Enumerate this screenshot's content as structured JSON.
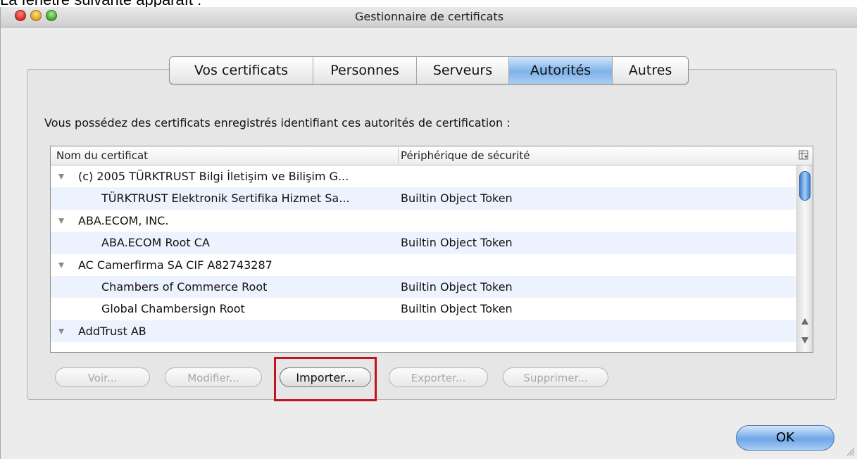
{
  "caption": "La fenêtre suivante apparaît :",
  "window": {
    "title": "Gestionnaire de certificats"
  },
  "tabs": [
    {
      "label": "Vos certificats",
      "active": false
    },
    {
      "label": "Personnes",
      "active": false
    },
    {
      "label": "Serveurs",
      "active": false
    },
    {
      "label": "Autorités",
      "active": true
    },
    {
      "label": "Autres",
      "active": false
    }
  ],
  "description": "Vous possédez des certificats enregistrés identifiant ces autorités de certification :",
  "table": {
    "headers": [
      "Nom du certificat",
      "Périphérique de sécurité"
    ],
    "rows": [
      {
        "name": "(c) 2005 TÜRKTRUST Bilgi İletişim ve Bilişim G...",
        "device": "",
        "group": true
      },
      {
        "name": "TÜRKTRUST Elektronik Sertifika Hizmet Sa...",
        "device": "Builtin Object Token",
        "group": false
      },
      {
        "name": "ABA.ECOM, INC.",
        "device": "",
        "group": true
      },
      {
        "name": "ABA.ECOM Root CA",
        "device": "Builtin Object Token",
        "group": false
      },
      {
        "name": "AC Camerfirma SA CIF A82743287",
        "device": "",
        "group": true
      },
      {
        "name": "Chambers of Commerce Root",
        "device": "Builtin Object Token",
        "group": false
      },
      {
        "name": "Global Chambersign Root",
        "device": "Builtin Object Token",
        "group": false
      },
      {
        "name": "AddTrust AB",
        "device": "",
        "group": true
      }
    ]
  },
  "buttons": {
    "view": "Voir...",
    "edit": "Modifier...",
    "import": "Importer...",
    "export": "Exporter...",
    "delete": "Supprimer..."
  },
  "ok": "OK",
  "colors": {
    "highlight": "#c0141f",
    "accent": "#6fa6e6"
  }
}
